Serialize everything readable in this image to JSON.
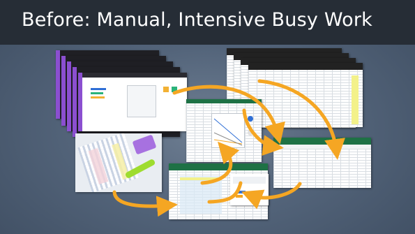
{
  "slide": {
    "title": "Before: Manual, Intensive Busy Work",
    "colors": {
      "title_bar": "#262d36",
      "title_text": "#ffffff",
      "background": "#53647a",
      "arrow": "#f5a623",
      "excel_green": "#1e7145",
      "highlight_yellow": "#f3f18a",
      "accent_purple": "#8b4fd0"
    }
  }
}
